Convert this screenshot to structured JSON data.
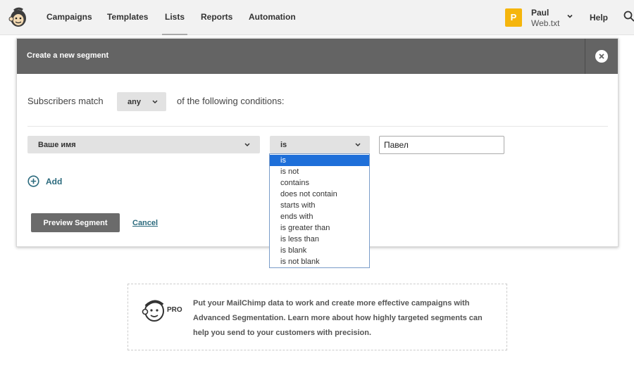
{
  "nav": {
    "items": [
      {
        "label": "Campaigns"
      },
      {
        "label": "Templates"
      },
      {
        "label": "Lists",
        "active": true
      },
      {
        "label": "Reports"
      },
      {
        "label": "Automation"
      }
    ],
    "user": {
      "initial": "P",
      "name": "Paul",
      "account": "Web.txt"
    },
    "help_label": "Help",
    "icons": {
      "logo": "mailchimp-logo",
      "search": "search-icon",
      "chevron": "chevron-down-icon"
    },
    "avatar_color": "#f5b50c"
  },
  "modal": {
    "title": "Create a new segment",
    "match_prefix": "Subscribers match",
    "match_value": "any",
    "match_suffix": "of the following conditions:",
    "condition": {
      "field": "Ваше имя",
      "operator": "is",
      "value": "Павел"
    },
    "add_label": "Add",
    "preview_label": "Preview Segment",
    "cancel_label": "Cancel"
  },
  "operator_options": [
    "is",
    "is not",
    "contains",
    "does not contain",
    "starts with",
    "ends with",
    "is greater than",
    "is less than",
    "is blank",
    "is not blank"
  ],
  "selected_operator_index": 0,
  "promo": {
    "badge": "PRO",
    "text": "Put your MailChimp data to work and create more effective campaigns with Advanced Segmentation. Learn more about how highly targeted segments can help you send to your customers with precision."
  },
  "colors": {
    "header_bg": "#646464",
    "link": "#2b6a7d",
    "selection": "#1e6fd9"
  }
}
